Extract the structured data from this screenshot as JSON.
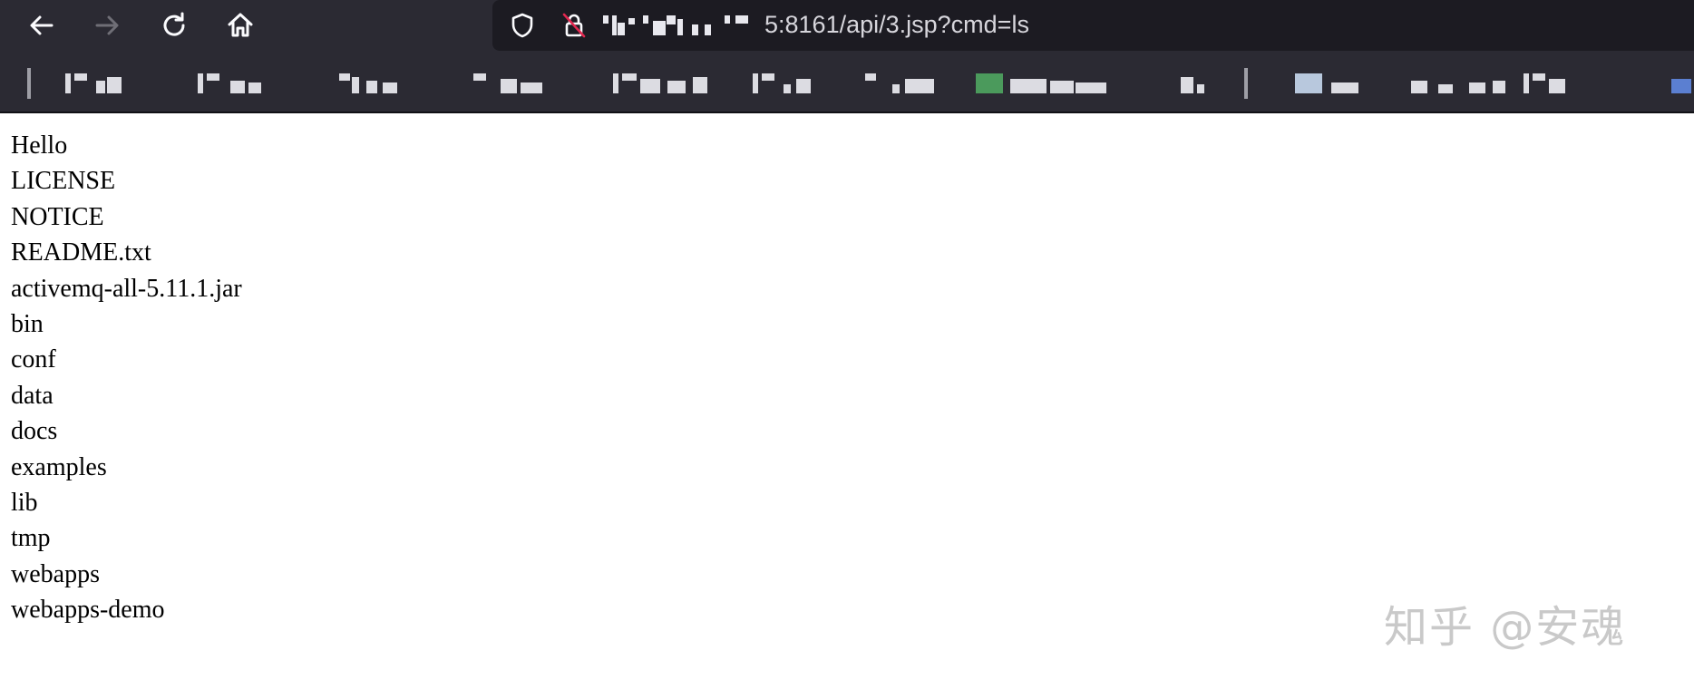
{
  "toolbar": {
    "back_icon": "arrow-left-icon",
    "forward_icon": "arrow-right-icon",
    "reload_icon": "reload-icon",
    "home_icon": "home-icon",
    "url_visible": "5:8161/api/3.jsp?cmd=ls"
  },
  "page": {
    "lines": [
      "Hello",
      "LICENSE",
      "NOTICE",
      "README.txt",
      "activemq-all-5.11.1.jar",
      "bin",
      "conf",
      "data",
      "docs",
      "examples",
      "lib",
      "tmp",
      "webapps",
      "webapps-demo"
    ]
  },
  "watermark": {
    "text": "知乎 @安魂"
  },
  "colors": {
    "chrome_bg": "#2b2a33",
    "urlbar_bg": "#1c1b22",
    "page_bg": "#ffffff",
    "page_text": "#000000"
  }
}
